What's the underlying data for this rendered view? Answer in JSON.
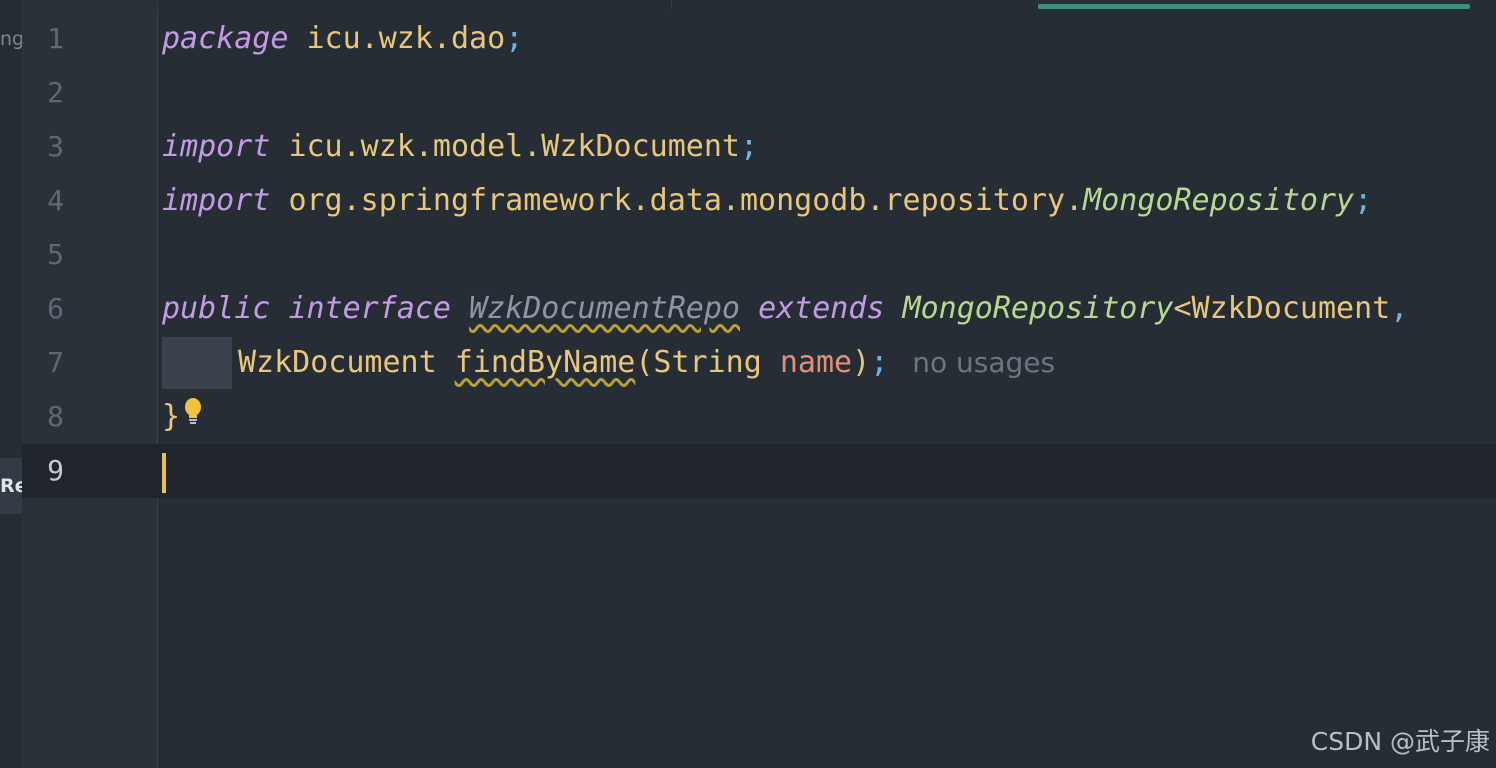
{
  "sidebar": {
    "fragment_top": "ng",
    "fragment_selected": "Re"
  },
  "editor": {
    "lines": [
      {
        "number": "1",
        "tokens": {
          "kw": "package",
          "pkg": "icu.wzk.dao",
          "semi": ";"
        }
      },
      {
        "number": "2"
      },
      {
        "number": "3",
        "tokens": {
          "kw": "import",
          "pkg": "icu.wzk.model.WzkDocument",
          "semi": ";"
        }
      },
      {
        "number": "4",
        "tokens": {
          "kw": "import",
          "pkg": "org.springframework.data.mongodb.repository.",
          "iface": "MongoRepository",
          "semi": ";"
        }
      },
      {
        "number": "5"
      },
      {
        "number": "6",
        "tokens": {
          "kw1": "public",
          "kw2": "interface",
          "name": "WzkDocumentRepo",
          "kw3": "extends",
          "iface": "MongoRepository",
          "rest": "<WzkDocument",
          "comma": ","
        }
      },
      {
        "number": "7",
        "tokens": {
          "type": "WzkDocument",
          "method": "findByName",
          "open": "(String ",
          "param": "name",
          "close": ")",
          "semi": ";",
          "hint": "no usages"
        }
      },
      {
        "number": "8",
        "tokens": {
          "brace": "}"
        }
      },
      {
        "number": "9"
      }
    ]
  },
  "watermark": "CSDN @武子康",
  "colors": {
    "background": "#262d35",
    "keyword": "#c49ae6",
    "identifier": "#e8c67a",
    "caret": "#f0c237",
    "tab_indicator": "#3f8f7e"
  }
}
